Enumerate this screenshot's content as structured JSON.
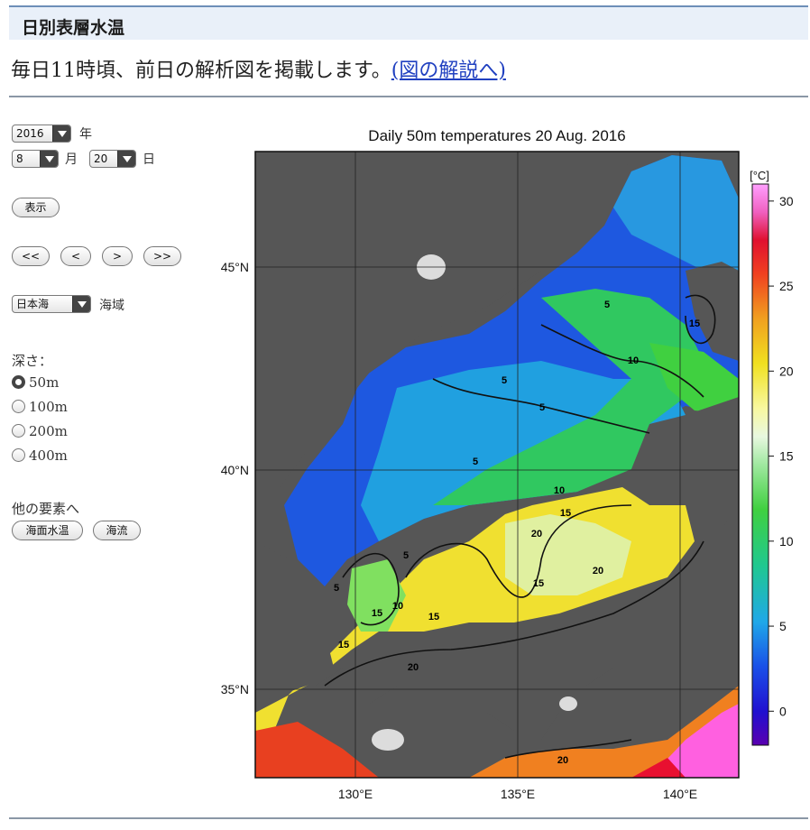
{
  "header": {
    "title": "日別表層水温"
  },
  "subtitle": {
    "text": "毎日11時頃、前日の解析図を掲載します。",
    "link_label": "(図の解説へ)"
  },
  "controls": {
    "year": {
      "value": "2016",
      "unit": "年"
    },
    "month": {
      "value": "8",
      "unit": "月"
    },
    "day": {
      "value": "20",
      "unit": "日"
    },
    "show_button": "表示",
    "nav_buttons": [
      "<<",
      "<",
      ">",
      ">>"
    ],
    "area": {
      "value": "日本海",
      "unit": "海域"
    },
    "depth": {
      "label": "深さ：",
      "options": [
        "50m",
        "100m",
        "200m",
        "400m"
      ],
      "selected": "50m"
    },
    "other": {
      "label": "他の要素へ",
      "buttons": [
        "海面水温",
        "海流"
      ]
    }
  },
  "map": {
    "title": "Daily 50m temperatures 20 Aug. 2016",
    "lat_ticks": [
      "45°N",
      "40°N",
      "35°N"
    ],
    "lon_ticks": [
      "130°E",
      "135°E",
      "140°E"
    ],
    "contour_labels": [
      "5",
      "5",
      "5",
      "5",
      "5",
      "5",
      "10",
      "10",
      "10",
      "15",
      "15",
      "15",
      "15",
      "15",
      "15",
      "20",
      "20",
      "20",
      "20"
    ],
    "colors": {
      "land": "#565656",
      "cold": "#1a2fd0",
      "cool": "#2aa0e0",
      "mid": "#32c850",
      "warm": "#f0e040",
      "hot": "#e83020",
      "hottest": "#ff80ff"
    }
  },
  "colorbar": {
    "unit": "[°C]",
    "ticks": [
      "30",
      "25",
      "20",
      "15",
      "10",
      "5",
      "0"
    ],
    "range": [
      -2,
      31
    ]
  }
}
